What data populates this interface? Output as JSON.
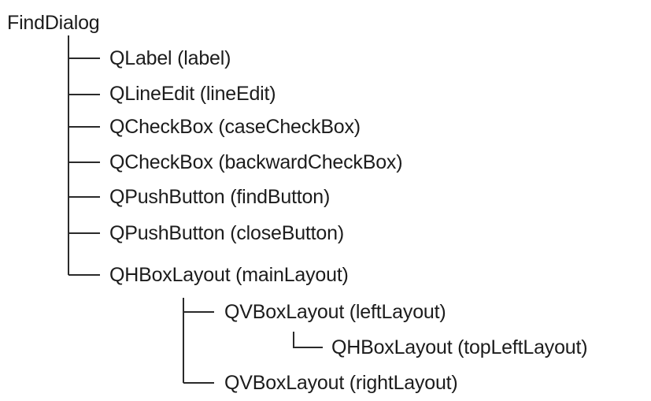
{
  "tree": {
    "root": "FindDialog",
    "children": [
      "QLabel (label)",
      "QLineEdit (lineEdit)",
      "QCheckBox (caseCheckBox)",
      "QCheckBox (backwardCheckBox)",
      "QPushButton (findButton)",
      "QPushButton (closeButton)",
      "QHBoxLayout (mainLayout)"
    ],
    "main_layout_children": [
      "QVBoxLayout (leftLayout)",
      "QVBoxLayout (rightLayout)"
    ],
    "left_layout_children": [
      "QHBoxLayout (topLeftLayout)"
    ]
  }
}
